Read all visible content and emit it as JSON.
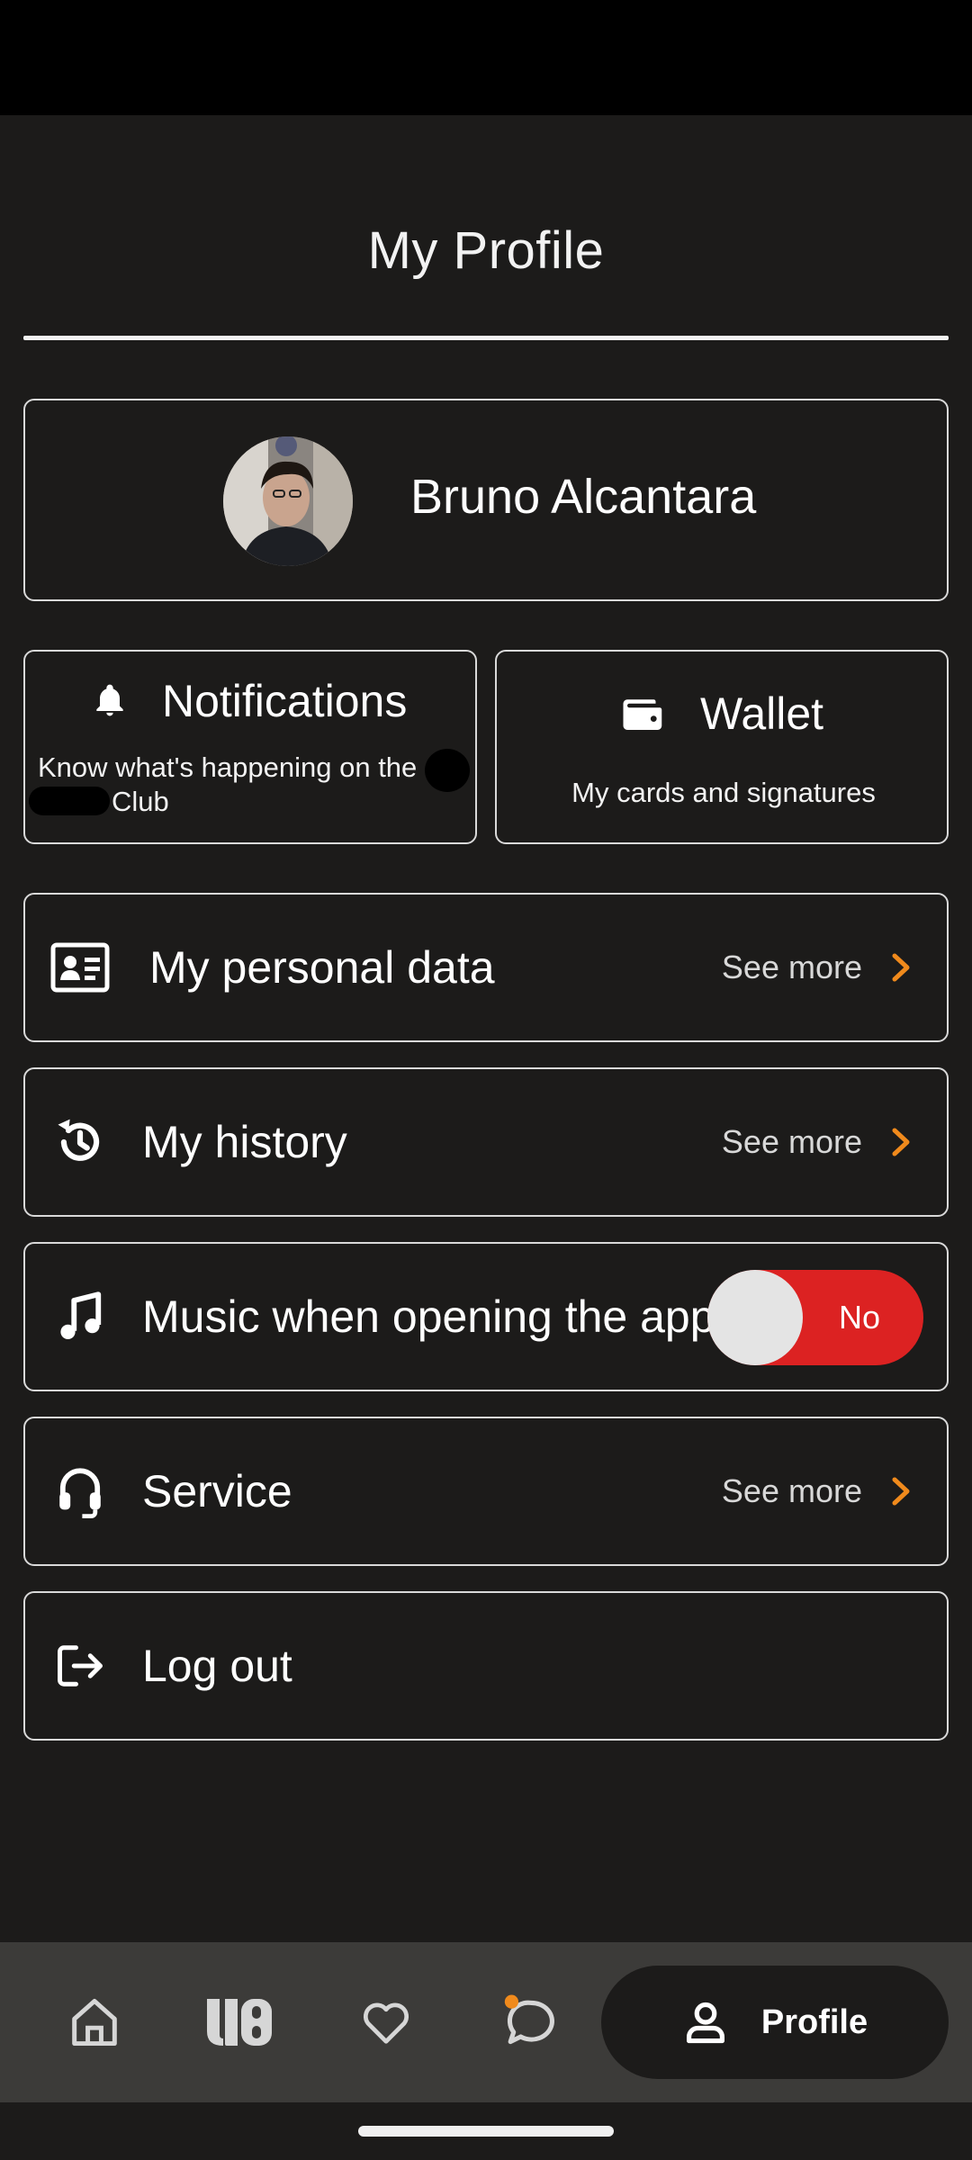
{
  "page": {
    "title": "My Profile"
  },
  "profile": {
    "name": "Bruno Alcantara"
  },
  "tiles": {
    "notifications": {
      "title": "Notifications",
      "line1": "Know what's happening on the",
      "line2": "Club"
    },
    "wallet": {
      "title": "Wallet",
      "subtitle": "My cards and signatures"
    }
  },
  "rows": {
    "personal_data": {
      "label": "My personal data",
      "action": "See more"
    },
    "history": {
      "label": "My history",
      "action": "See more"
    },
    "music": {
      "label": "Music when opening the app",
      "toggle_text": "No",
      "toggle_on": false
    },
    "service": {
      "label": "Service",
      "action": "See more"
    },
    "logout": {
      "label": "Log out"
    }
  },
  "nav": {
    "items": [
      "home-icon",
      "brand-logo-icon",
      "heart-icon",
      "chat-icon"
    ],
    "active": {
      "label": "Profile"
    }
  },
  "colors": {
    "background": "#1c1b1a",
    "accent_orange": "#f08a1c",
    "toggle_red": "#dc2222",
    "nav_bg": "#3c3b39"
  }
}
